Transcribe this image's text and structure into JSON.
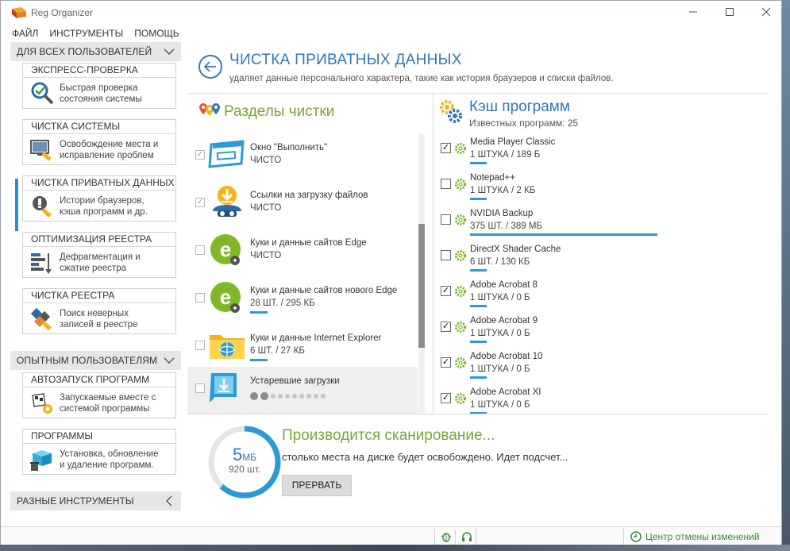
{
  "window": {
    "title": "Reg Organizer"
  },
  "menu": [
    "ФАЙЛ",
    "ИНСТРУМЕНТЫ",
    "ПОМОЩЬ"
  ],
  "sidebar": {
    "group_all": "ДЛЯ ВСЕХ ПОЛЬЗОВАТЕЛЕЙ",
    "group_expert": "ОПЫТНЫМ ПОЛЬЗОВАТЕЛЯМ",
    "group_misc": "РАЗНЫЕ ИНСТРУМЕНТЫ",
    "cards": [
      {
        "title": "ЭКСПРЕСС-ПРОВЕРКА",
        "desc": "Быстрая проверка\nсостояния системы",
        "icon": "magnifier-check-icon"
      },
      {
        "title": "ЧИСТКА СИСТЕМЫ",
        "desc": "Освобождение места и\nисправление проблем",
        "icon": "system-cleanup-icon"
      },
      {
        "title": "ЧИСТКА ПРИВАТНЫХ ДАННЫХ",
        "desc": "Истории браузеров,\nкэша программ и др.",
        "icon": "private-data-icon"
      },
      {
        "title": "ОПТИМИЗАЦИЯ РЕЕСТРА",
        "desc": "Дефрагментация и\nсжатие реестра",
        "icon": "registry-defrag-icon"
      },
      {
        "title": "ЧИСТКА РЕЕСТРА",
        "desc": "Поиск неверных\nзаписей в реестре",
        "icon": "registry-cleanup-icon"
      },
      {
        "title": "АВТОЗАПУСК ПРОГРАММ",
        "desc": "Запускаемые вместе с\nсистемой программы",
        "icon": "autorun-icon"
      },
      {
        "title": "ПРОГРАММЫ",
        "desc": "Установка, обновление\nи удаление программ.",
        "icon": "programs-icon"
      }
    ]
  },
  "page": {
    "title": "ЧИСТКА ПРИВАТНЫХ ДАННЫХ",
    "subtitle": "удаляет данные персонального характера, такие как история браузеров и списки файлов."
  },
  "sections": {
    "title": "Разделы чистки",
    "items": [
      {
        "name": "Окно \"Выполнить\"",
        "status": "ЧИСТО",
        "checked": true
      },
      {
        "name": "Ссылки на загрузку файлов",
        "status": "ЧИСТО",
        "checked": true
      },
      {
        "name": "Куки и данные сайтов Edge",
        "status": "ЧИСТО",
        "checked": false
      },
      {
        "name": "Куки и данные сайтов нового Edge",
        "status": "28 ШТ. / 295 КБ",
        "checked": false
      },
      {
        "name": "Куки и данные Internet Explorer",
        "status": "6 ШТ. / 27 КБ",
        "checked": false
      },
      {
        "name": "Устаревшие загрузки",
        "status": "",
        "checked": false
      }
    ]
  },
  "cache": {
    "title": "Кэш программ",
    "subtitle": "Известных программ: 25",
    "items": [
      {
        "name": "Media Player Classic",
        "size": "1 ШТУКА / 189 Б",
        "checked": true,
        "bar": 0.09
      },
      {
        "name": "Notepad++",
        "size": "1 ШТУКА / 2 КБ",
        "checked": false,
        "bar": 0.09
      },
      {
        "name": "NVIDIA Backup",
        "size": "375 ШТ. / 389 МБ",
        "checked": false,
        "bar": 1.0
      },
      {
        "name": "DirectX Shader Cache",
        "size": "6 ШТ. / 130 КБ",
        "checked": false,
        "bar": 0.09
      },
      {
        "name": "Adobe Acrobat 8",
        "size": "1 ШТУКА / 0 Б",
        "checked": true,
        "bar": 0.09
      },
      {
        "name": "Adobe Acrobat 9",
        "size": "1 ШТУКА / 0 Б",
        "checked": true,
        "bar": 0.09
      },
      {
        "name": "Adobe Acrobat 10",
        "size": "1 ШТУКА / 0 Б",
        "checked": true,
        "bar": 0.09
      },
      {
        "name": "Adobe Acrobat XI",
        "size": "1 ШТУКА / 0 Б",
        "checked": true,
        "bar": 0.09
      }
    ]
  },
  "scan": {
    "size_value": "5",
    "size_unit": "МБ",
    "count": "920 шт.",
    "title": "Производится сканирование...",
    "desc": "столько места на диске будет освобождено. Идет подсчет...",
    "stop_label": "ПРЕРВАТЬ",
    "progress": 0.62
  },
  "statusbar": {
    "undo_center": "Центр отмены изменений"
  },
  "colors": {
    "accent_blue": "#2e78b8",
    "accent_green": "#79a637",
    "progress_blue": "#2b9bd8"
  }
}
